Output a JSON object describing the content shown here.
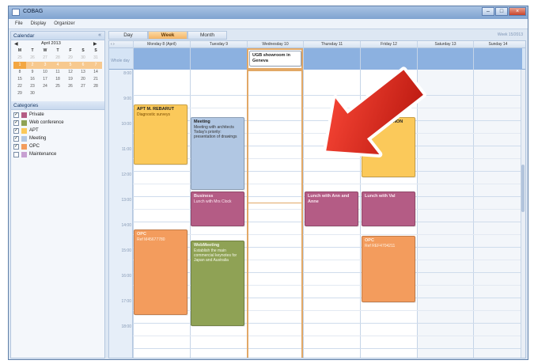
{
  "window": {
    "title": "COBAG"
  },
  "menu": [
    "File",
    "Display",
    "Organizer"
  ],
  "left": {
    "calendar_title": "Calendar",
    "month_label": "April 2013",
    "nav_prev": "◀",
    "nav_next": "▶",
    "dow": [
      "M",
      "T",
      "W",
      "T",
      "F",
      "S",
      "S"
    ],
    "rows": [
      [
        "25",
        "26",
        "27",
        "28",
        "29",
        "30",
        "31"
      ],
      [
        "1",
        "2",
        "3",
        "4",
        "5",
        "6",
        "7"
      ],
      [
        "8",
        "9",
        "10",
        "11",
        "12",
        "13",
        "14"
      ],
      [
        "15",
        "16",
        "17",
        "18",
        "19",
        "20",
        "21"
      ],
      [
        "22",
        "23",
        "24",
        "25",
        "26",
        "27",
        "28"
      ],
      [
        "29",
        "30",
        "",
        "",
        "",
        "",
        ""
      ]
    ],
    "categories_title": "Categories",
    "categories": [
      {
        "label": "Private",
        "color": "#b45c85",
        "checked": "✓"
      },
      {
        "label": "Web conference",
        "color": "#8fa255",
        "checked": "✓"
      },
      {
        "label": "APT",
        "color": "#fbc95a",
        "checked": "✓"
      },
      {
        "label": "Meeting",
        "color": "#b1c7e3",
        "checked": "✓"
      },
      {
        "label": "OPC",
        "color": "#f39c5d",
        "checked": "✓"
      },
      {
        "label": "Maintenance",
        "color": "#c7a0d2",
        "checked": ""
      }
    ]
  },
  "tabs": [
    "Day",
    "Week",
    "Month"
  ],
  "week_label": "Week 15/2013",
  "header_nav": "‹  ›",
  "days": [
    "Monday 8 (April)",
    "Tuesday 9",
    "Wednesday 10",
    "Thursday 11",
    "Friday 12",
    "Saturday 13",
    "Sunday 14"
  ],
  "allday_label": "Whole day",
  "times": [
    "8:00",
    "9:00",
    "10:00",
    "11:00",
    "12:00",
    "13:00",
    "14:00",
    "15:00",
    "16:00",
    "17:00",
    "18:00"
  ],
  "appointments": {
    "ugb": {
      "title": "UGB showroom in Geneva"
    },
    "apt": {
      "title": "APT M. REBARUT",
      "desc": "Diagnostic surveys"
    },
    "meeting": {
      "title": "Meeting",
      "desc": "Meeting with architects Today's priority: presentation of drawings"
    },
    "private_fri_top": {
      "title": "NON"
    },
    "business": {
      "title": "Business",
      "desc": "Lunch with Mrs Clock"
    },
    "lunch_thu": {
      "title": "Lunch with Ann and Anne"
    },
    "lunch_fri": {
      "title": "Lunch with Val"
    },
    "opc_mon": {
      "title": "OPC",
      "desc": "Ref M45677780"
    },
    "webmeeting": {
      "title": "WebMeeting",
      "desc": "Establish the main commercial keynotes for Japan and Australia"
    },
    "opc_fri": {
      "title": "OPC",
      "desc": "Ref REF4704211"
    }
  },
  "colors": {
    "accent": "#f5b565",
    "arrow": "#d9261c",
    "selection": "#e2a866"
  }
}
